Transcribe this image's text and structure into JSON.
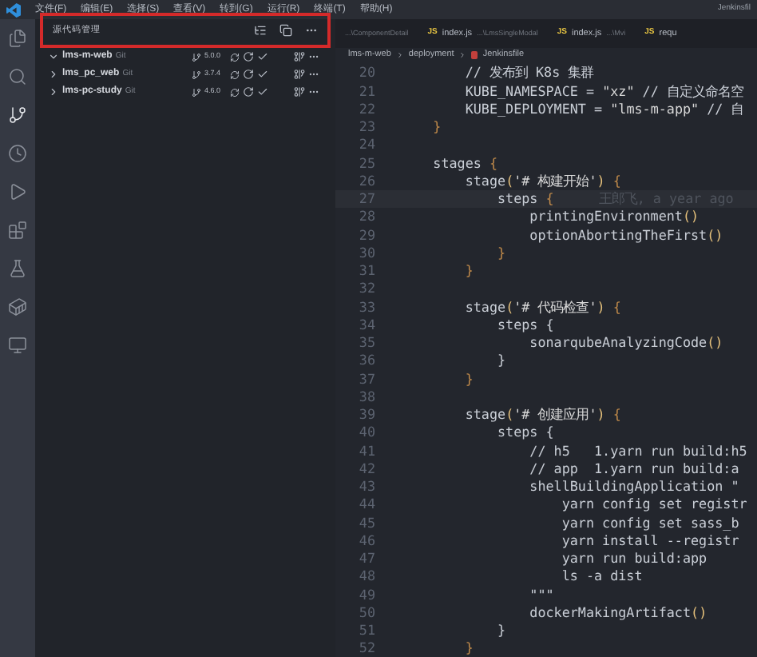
{
  "menu": [
    "文件(F)",
    "编辑(E)",
    "选择(S)",
    "查看(V)",
    "转到(G)",
    "运行(R)",
    "终端(T)",
    "帮助(H)"
  ],
  "window_title": "Jenkinsfil",
  "activity_bar": [
    {
      "kind": "files",
      "selected": false
    },
    {
      "kind": "search",
      "selected": false
    },
    {
      "kind": "source-control",
      "selected": true
    },
    {
      "kind": "timeline",
      "selected": false
    },
    {
      "kind": "run",
      "selected": false
    },
    {
      "kind": "extensions",
      "selected": false
    },
    {
      "kind": "testing",
      "selected": false
    },
    {
      "kind": "docker",
      "selected": false
    },
    {
      "kind": "remote",
      "selected": false
    }
  ],
  "sidebar": {
    "title": "源代码管理",
    "highlighted": true,
    "repositories": [
      {
        "name": "lms-m-web",
        "provider": "Git",
        "expanded": true,
        "branch": "5.0.0"
      },
      {
        "name": "lms_pc_web",
        "provider": "Git",
        "expanded": false,
        "branch": "3.7.4"
      },
      {
        "name": "lms-pc-study",
        "provider": "Git",
        "expanded": false,
        "branch": "4.6.0"
      }
    ]
  },
  "tabs": [
    {
      "path": "...\\ComponentDetail",
      "selected": false
    },
    {
      "icon": "JS",
      "name": "index.js",
      "path": "...\\LmsSingleModal",
      "selected": false
    },
    {
      "icon": "JS",
      "name": "index.js",
      "path": "...\\Mvi",
      "selected": false
    },
    {
      "icon": "JS",
      "name": "requ",
      "selected": false
    }
  ],
  "breadcrumbs": [
    "lms-m-web",
    "deployment",
    "Jenkinsfile"
  ],
  "code": [
    {
      "number": "20",
      "tokens": [
        {
          "kind": "comment",
          "text": "        // 发布到 K8s 集群"
        }
      ]
    },
    {
      "number": "21",
      "tokens": [
        {
          "kind": "plain",
          "text": "        KUBE_NAMESPACE = "
        },
        {
          "kind": "string",
          "text": "\"xz\""
        },
        {
          "kind": "comment",
          "text": " // 自定义命名空"
        }
      ]
    },
    {
      "number": "22",
      "tokens": [
        {
          "kind": "plain",
          "text": "        KUBE_DEPLOYMENT = "
        },
        {
          "kind": "string",
          "text": "\"lms-m-app\""
        },
        {
          "kind": "comment",
          "text": " // 自"
        }
      ]
    },
    {
      "number": "23",
      "tokens": [
        {
          "kind": "bracket",
          "text": "    }"
        }
      ]
    },
    {
      "number": "24"
    },
    {
      "number": "25",
      "tokens": [
        {
          "kind": "plain",
          "text": "    stages "
        },
        {
          "kind": "bracket",
          "text": "{"
        }
      ]
    },
    {
      "number": "26",
      "tokens": [
        {
          "kind": "plain",
          "text": "        stage"
        },
        {
          "kind": "paren",
          "text": "("
        },
        {
          "kind": "string",
          "text": "'# 构建开始'"
        },
        {
          "kind": "paren",
          "text": ")"
        },
        {
          "kind": "bracket",
          "text": " {"
        }
      ]
    },
    {
      "number": "27",
      "current": true,
      "blame": "王郎飞, a year ago",
      "tokens": [
        {
          "kind": "plain",
          "text": "            steps "
        },
        {
          "kind": "bracket",
          "text": "{"
        }
      ]
    },
    {
      "number": "28",
      "tokens": [
        {
          "kind": "plain",
          "text": "                printingEnvironment"
        },
        {
          "kind": "paren",
          "text": "()"
        }
      ]
    },
    {
      "number": "29",
      "tokens": [
        {
          "kind": "plain",
          "text": "                optionAbortingTheFirst"
        },
        {
          "kind": "paren",
          "text": "()"
        }
      ]
    },
    {
      "number": "30",
      "tokens": [
        {
          "kind": "bracket",
          "text": "            }"
        }
      ]
    },
    {
      "number": "31",
      "tokens": [
        {
          "kind": "bracket",
          "text": "        }"
        }
      ]
    },
    {
      "number": "32"
    },
    {
      "number": "33",
      "tokens": [
        {
          "kind": "plain",
          "text": "        stage"
        },
        {
          "kind": "paren",
          "text": "("
        },
        {
          "kind": "string",
          "text": "'# 代码检查'"
        },
        {
          "kind": "paren",
          "text": ")"
        },
        {
          "kind": "bracket",
          "text": " {"
        }
      ]
    },
    {
      "number": "34",
      "tokens": [
        {
          "kind": "plain",
          "text": "            steps {"
        }
      ]
    },
    {
      "number": "35",
      "tokens": [
        {
          "kind": "plain",
          "text": "                sonarqubeAnalyzingCode"
        },
        {
          "kind": "paren",
          "text": "()"
        }
      ]
    },
    {
      "number": "36",
      "tokens": [
        {
          "kind": "plain",
          "text": "            }"
        }
      ]
    },
    {
      "number": "37",
      "tokens": [
        {
          "kind": "bracket",
          "text": "        }"
        }
      ]
    },
    {
      "number": "38"
    },
    {
      "number": "39",
      "tokens": [
        {
          "kind": "plain",
          "text": "        stage"
        },
        {
          "kind": "paren",
          "text": "("
        },
        {
          "kind": "string",
          "text": "'# 创建应用'"
        },
        {
          "kind": "paren",
          "text": ")"
        },
        {
          "kind": "bracket",
          "text": " {"
        }
      ]
    },
    {
      "number": "40",
      "tokens": [
        {
          "kind": "plain",
          "text": "            steps {"
        }
      ]
    },
    {
      "number": "41",
      "tokens": [
        {
          "kind": "plain",
          "text": "                // h5   1.yarn run build:h5"
        }
      ]
    },
    {
      "number": "42",
      "tokens": [
        {
          "kind": "plain",
          "text": "                // app  1.yarn run build:a"
        }
      ]
    },
    {
      "number": "43",
      "tokens": [
        {
          "kind": "plain",
          "text": "                shellBuildingApplication \""
        }
      ]
    },
    {
      "number": "44",
      "tokens": [
        {
          "kind": "plain",
          "text": "                    yarn config set registr"
        }
      ]
    },
    {
      "number": "45",
      "tokens": [
        {
          "kind": "plain",
          "text": "                    yarn config set sass_b"
        }
      ]
    },
    {
      "number": "46",
      "tokens": [
        {
          "kind": "plain",
          "text": "                    yarn install --registr"
        }
      ]
    },
    {
      "number": "47",
      "tokens": [
        {
          "kind": "plain",
          "text": "                    yarn run build:app"
        }
      ]
    },
    {
      "number": "48",
      "tokens": [
        {
          "kind": "plain",
          "text": "                    ls -a dist"
        }
      ]
    },
    {
      "number": "49",
      "tokens": [
        {
          "kind": "plain",
          "text": "                \"\"\""
        }
      ]
    },
    {
      "number": "50",
      "tokens": [
        {
          "kind": "plain",
          "text": "                dockerMakingArtifact"
        },
        {
          "kind": "paren",
          "text": "()"
        }
      ]
    },
    {
      "number": "51",
      "tokens": [
        {
          "kind": "plain",
          "text": "            }"
        }
      ]
    },
    {
      "number": "52",
      "tokens": [
        {
          "kind": "bracket",
          "text": "        }"
        }
      ]
    }
  ]
}
